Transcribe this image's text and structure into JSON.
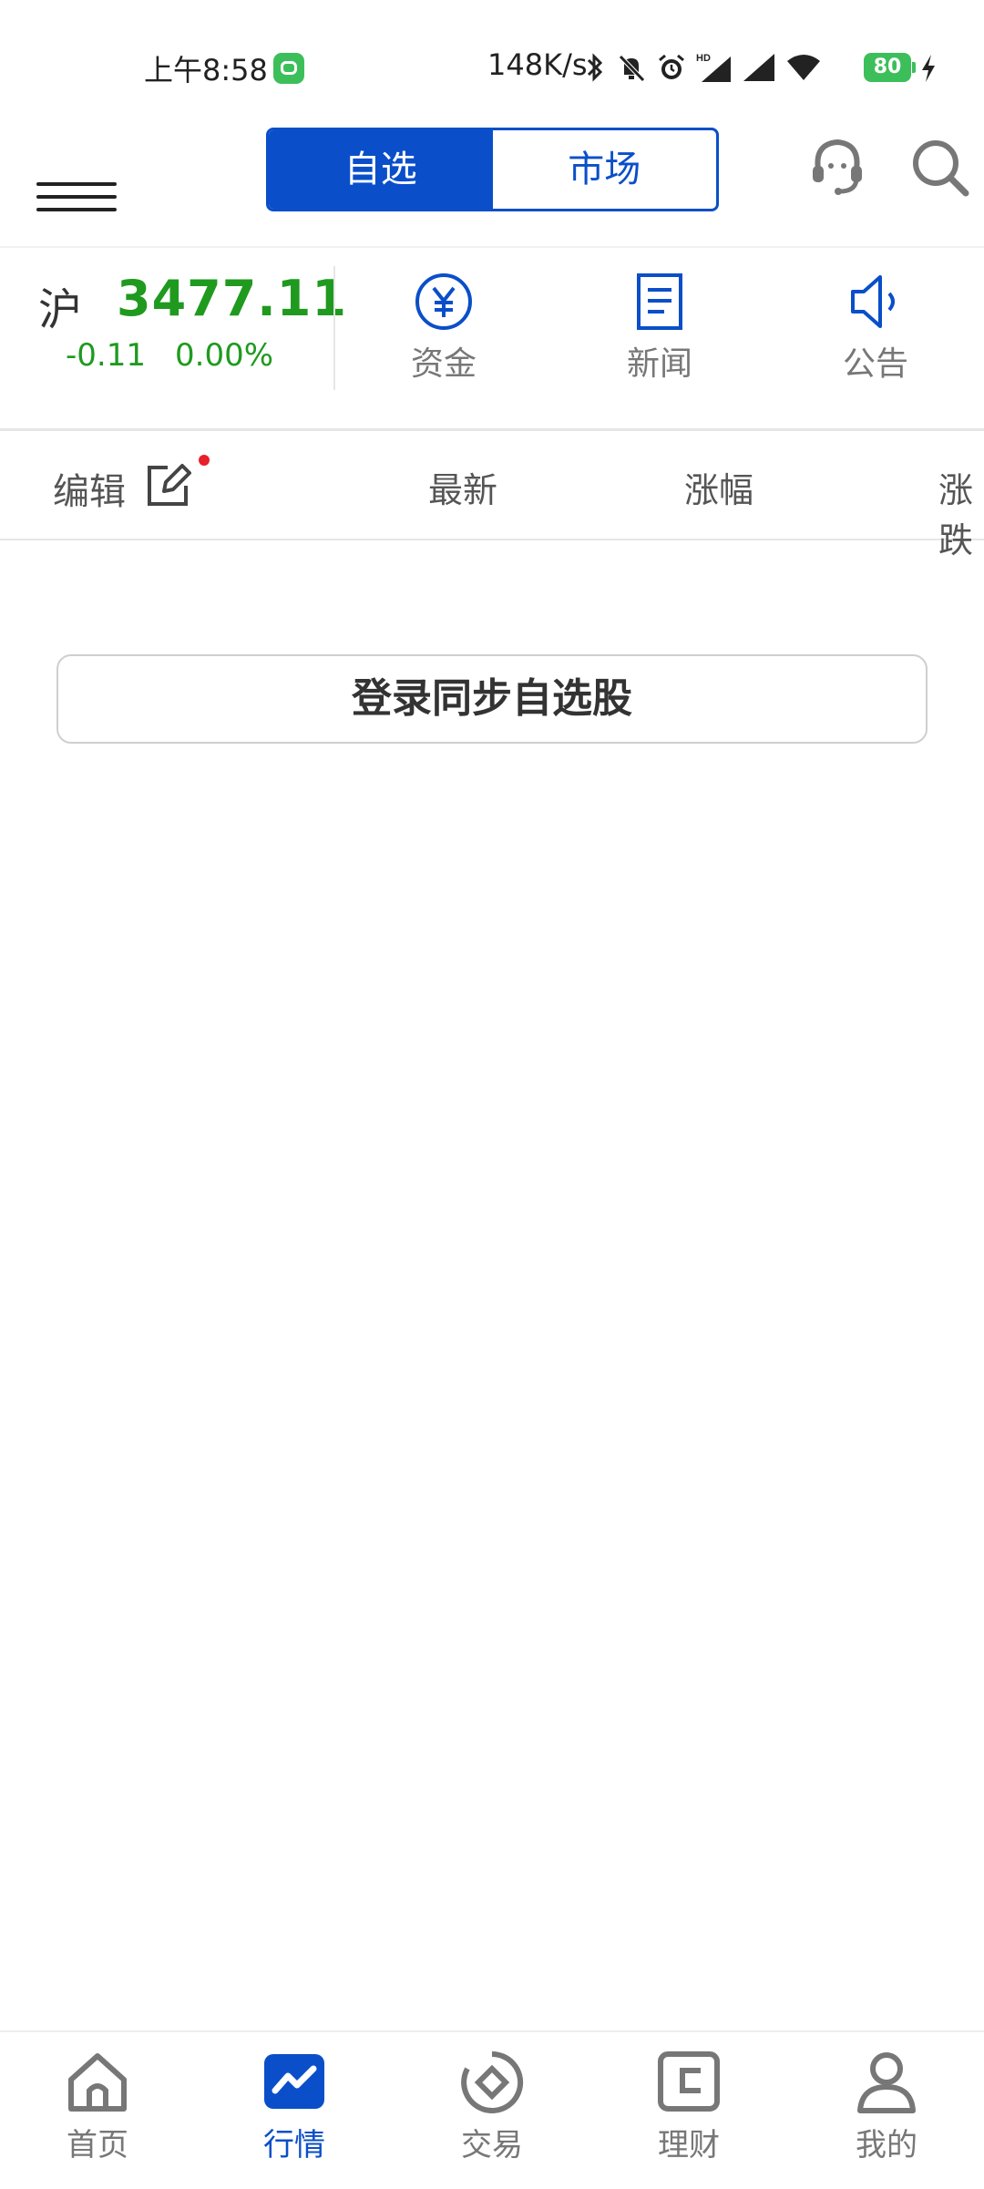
{
  "status_bar": {
    "time": "上午8:58",
    "net_speed": "148K/s",
    "battery": "80",
    "icons": [
      "bluetooth-icon",
      "mute-bell-icon",
      "alarm-icon",
      "hd-signal-icon",
      "signal-icon",
      "wifi-icon",
      "battery-icon",
      "charging-icon"
    ]
  },
  "header": {
    "tabs": [
      {
        "label": "自选",
        "active": true
      },
      {
        "label": "市场",
        "active": false
      }
    ]
  },
  "index": {
    "name": "沪",
    "value": "3477.11",
    "change": "-0.11",
    "change_pct": "0.00%",
    "color": "#1f9a1f"
  },
  "quick_links": [
    {
      "label": "资金",
      "icon": "yuan-circle-icon"
    },
    {
      "label": "新闻",
      "icon": "document-icon"
    },
    {
      "label": "公告",
      "icon": "speaker-icon"
    }
  ],
  "list_header": {
    "edit_label": "编辑",
    "columns": [
      "最新",
      "涨幅",
      "涨跌"
    ]
  },
  "login_button": "登录同步自选股",
  "bottom_nav": [
    {
      "label": "首页",
      "icon": "home-icon",
      "active": false
    },
    {
      "label": "行情",
      "icon": "market-chart-icon",
      "active": true
    },
    {
      "label": "交易",
      "icon": "trade-icon",
      "active": false
    },
    {
      "label": "理财",
      "icon": "wallet-icon",
      "active": false
    },
    {
      "label": "我的",
      "icon": "user-icon",
      "active": false
    }
  ],
  "colors": {
    "accent": "#0a4fc9",
    "up_down_green": "#1f9a1f",
    "notify_red": "#e8202a"
  }
}
